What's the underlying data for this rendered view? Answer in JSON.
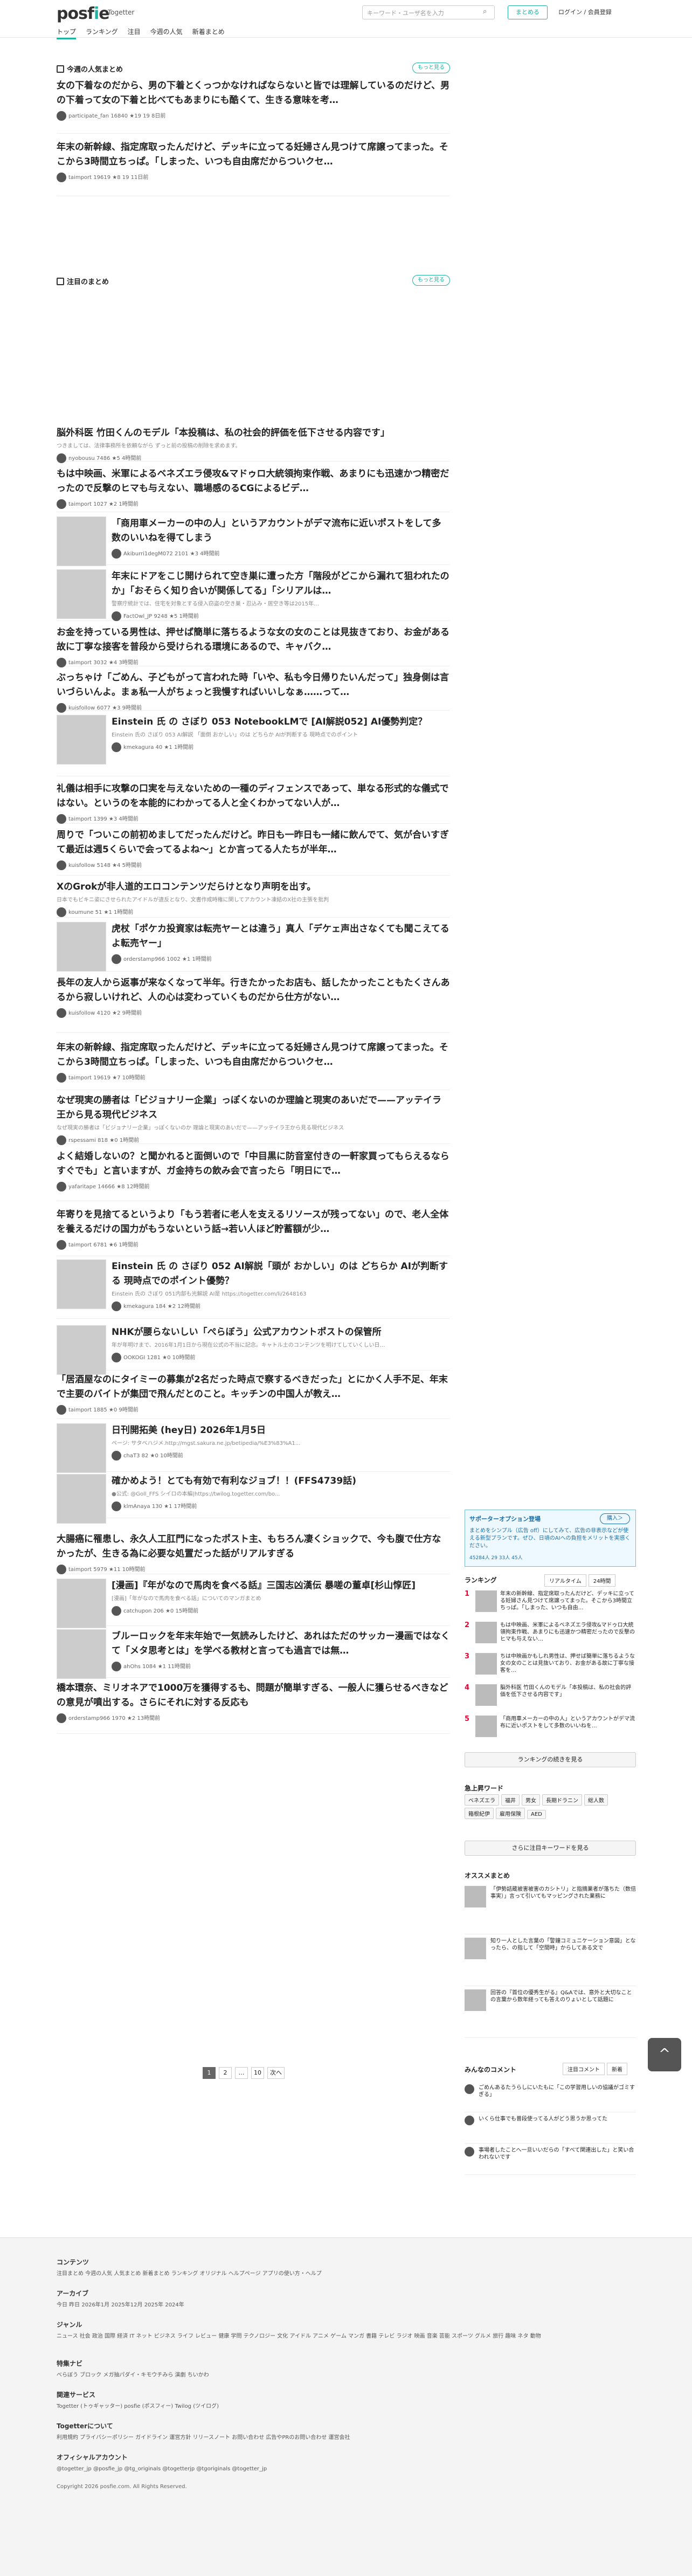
{
  "header": {
    "logo": "posfie",
    "sublogo": "Togetter",
    "search_placeholder": "キーワード・ユーザ名を入力",
    "match_btn": "まとめる",
    "login": "ログイン / 会員登録"
  },
  "nav": [
    "トップ",
    "ランキング",
    "注目",
    "今週の人気",
    "新着まとめ"
  ],
  "popular": {
    "title": "今週の人気まとめ",
    "more": "もっと見る",
    "items": [
      {
        "title": "女の下着なのだから、男の下着とくっつかなければならないと皆では理解しているのだけど、男の下着って女の下着と比べてもあまりにも酷くて、生きる意味を考…",
        "meta": "participate_fan 16840 ★19 19 8日前"
      },
      {
        "title": "年末の新幹線、指定席取ったんだけど、デッキに立ってる妊婦さん見つけて席譲ってまった。そこから3時間立ちっぱ。「しまった、いつも自由席だからついクセ…",
        "meta": "taimport 19619 ★8 19 11日前"
      }
    ]
  },
  "featured": {
    "title": "注目のまとめ",
    "more": "もっと見る",
    "items": [
      {
        "title": "脳外科医 竹田くんのモデル「本投稿は、私の社会的評価を低下させる内容です」",
        "desc": "つきましては、法律事務所を依頼ながら ずっと前の投稿の削除を求めます。",
        "meta": "nyobousu 7486 ★5 4時間前"
      },
      {
        "title": "もは中映画、米軍によるベネズエラ侵攻&マドゥロ大統領拘束作戦、あまりにも迅速かつ精密だったので反撃のヒマも与えない、職場感のるCGによるビデ…",
        "meta": "taimport 1027 ★2 1時間前"
      },
      {
        "title": "「商用車メーカーの中の人」というアカウントがデマ流布に近いポストをして多数のいいねを得てしまう",
        "meta": "Akiburri1degM072 2101 ★3 4時間前"
      },
      {
        "title": "年末にドアをこじ開けられて空き巣に遭った方「階段がどこから漏れて狙われたのか」「おそらく知り合いが関係してる」「シリアルは…",
        "desc": "警察庁統計では、住宅を対象とする侵入窃盗の空き巣・忍込み・居空き等は2015年…",
        "meta": "FactOwl_JP 9248 ★5 1時間前"
      },
      {
        "title": "お金を持っている男性は、押せば簡単に落ちるような女の女のことは見抜きており、お金がある故に丁寧な接客を普段から受けられる環境にあるので、キャバク…",
        "meta": "taimport 3032 ★4 3時間前"
      },
      {
        "title": "ぶっちゃけ「ごめん、子どもがって言われた時「いや、私も今日帰りたいんだって」独身側は言いづらいんよ。まぁ私一人がちょっと我慢すればいいしなぁ……って…",
        "meta": "kuisfollow 6077 ★3 9時間前"
      },
      {
        "title": "Einstein 氏 の さぼり 053 NotebookLMで [AI解説052] AI優勢判定？",
        "desc": "Einstein 氏の さぼり 053 AI解説 「面倒 おかしい」のは どちらか AIが判断する 現時点でのポイント",
        "meta": "kmekagura 40 ★1 1時間前"
      },
      {
        "title": "礼儀は相手に攻撃の口実を与えないための一種のディフェンスであって、単なる形式的な儀式ではない。というのを本能的にわかってる人と全くわかってない人が…",
        "meta": "taimport 1399 ★3 4時間前"
      },
      {
        "title": "周りで「ついこの前初めましてだったんだけど。昨日も一昨日も一緒に飲んでて、気が合いすぎて最近は週5くらいで会ってるよね〜」とか言ってる人たちが半年…",
        "meta": "kuisfollow 5148 ★4 5時間前"
      },
      {
        "title": "XのGrokが非人道的エロコンテンツだらけとなり声明を出す。",
        "desc": "日本でもビキニ姿にさせられたアイドルが違反となり、文書作成時権に関してアカウント凍結のX社の主張を批判",
        "meta": "koumune 51 ★1 1時間前"
      },
      {
        "title": "虎杖「ポケカ投資家は転売ヤーとは違う」真人「デケェ声出さなくても聞こえてるよ転売ヤー」",
        "meta": "orderstamp966 1002 ★1 1時間前"
      },
      {
        "title": "長年の友人から返事が来なくなって半年。行きたかったお店も、話したかったこともたくさんあるから寂しいけれど、人の心は変わっていくものだから仕方がない…",
        "meta": "kuisfollow 4120 ★2 9時間前"
      },
      {
        "title": "年末の新幹線、指定席取ったんだけど、デッキに立ってる妊婦さん見つけて席譲ってまった。そこから3時間立ちっぱ。「しまった、いつも自由席だからついクセ…",
        "meta": "taimport 19619 ★7 10時間前"
      },
      {
        "title": "なぜ現実の勝者は「ビジョナリー企業」っぽくないのか理論と現実のあいだで——アッテイラ王から見る現代ビジネス",
        "desc": "なぜ現実の勝者は「ビジョナリー企業」っぽくないのか 理論と現実のあいだで——アッテイラ王から見る現代ビジネス",
        "meta": "rspessami 818 ★0 1時間前"
      },
      {
        "title": "よく結婚しないの？と聞かれると面倒いので「中目黒に防音室付きの一軒家買ってもらえるならすぐでも」と言いますが、ガ金持ちの飲み会で言ったら「明日にで…",
        "meta": "yafaritape 14666 ★8 12時間前"
      },
      {
        "title": "年寄りを見捨てるというより「もう若者に老人を支えるリソースが残ってない」ので、老人全体を養えるだけの国力がもうないという話→若い人ほど貯蓄額が少…",
        "meta": "taimport 6781 ★6 1時間前"
      },
      {
        "title": "Einstein 氏 の さぼり 052 AI解説「頭が おかしい」のは どちらか AIが判断する 現時点でのポイント優勢？",
        "desc": "Einstein 氏の さぼり 051内部も光解説 AI是 https://togetter.com/li/2648163",
        "meta": "kmekagura 184 ★2 12時間前"
      },
      {
        "title": "NHKが腰らないしい「ぺらぼう」公式アカウントポストの保管所",
        "desc": "年が年明けまで、2016年1月1日から現在公式の不当に記念。キャトル土のコンテンツを明けてしていくしい日…",
        "meta": "OOKOGI 1281 ★0 10時間前"
      },
      {
        "title": "「居酒屋なのにタイミーの募集が2名だった時点で察するべきだった」とにかく人手不足、年末で主要のバイトが集団で飛んだとのこと。キッチンの中国人が教え…",
        "meta": "taimport 1885 ★0 9時間前"
      },
      {
        "title": "日刊開拓美 (hey日) 2026年1月5日",
        "desc": "ページ: サタベハジメ.http://mgst.sakura.ne.jp/betipedia/%E3%83%A1...",
        "meta": "chaT3 82 ★0 10時間前"
      },
      {
        "title": "確かめよう！とても有効で有利なジョブ！！(FFS4739話)",
        "desc": "●公式: @Goll_FFS シイロの本編|https://twilog.togetter.com/bo...",
        "meta": "klmAnaya 130 ★1 17時間前"
      },
      {
        "title": "大腸癌に罹患し、永久人工肛門になったポスト主、もちろん凄くショックで、今も腹で仕方なかったが、生きる為に必要な処置だった話がリアルすぎる",
        "meta": "taimport 5979 ★11 10時間前"
      },
      {
        "title": "[漫画]『年がなので馬肉を食べる話』三国志凶漢伝 暴嗟の董卓[杉山惇匠]",
        "desc": "[漫画]「年がなので馬肉を食べる話」についてのマンガまとめ",
        "meta": "catchupon 206 ★0 15時間前"
      },
      {
        "title": "ブルーロックを年末年始で一気読みしたけど、あれはただのサッカー漫画ではなくて「メタ思考とは」を学べる教材と言っても過言では無…",
        "meta": "ahOhs 1084 ★1 11時間前"
      },
      {
        "title": "橋本環奈、ミリオネアで1000万を獲得するも、問題が簡単すぎる、一般人に獲らせるべきなどの意見が噴出する。さらにそれに対する反応も",
        "meta": "orderstamp966 1970 ★2 13時間前"
      }
    ]
  },
  "pager": [
    "1",
    "2",
    "…",
    "10",
    "次へ"
  ],
  "sidebar": {
    "ad": {
      "title": "サポーターオプション登場",
      "join": "購入＞",
      "body": "まとめをシンプル（広告 off）にしてみて、広告の非表示などが使える新型プランです。ぜひ、日頃のAIへの負担をメリットを実感ください。",
      "stats": "45284人 29 33人 45人"
    },
    "ranking": {
      "title": "ランキング",
      "tabs": [
        "リアルタイム",
        "24時間"
      ],
      "items": [
        "年末の新幹線、指定席取ったんだけど、デッキに立ってる妊婦さん見つけて席譲ってまった。そこから3時間立ちっぱ。「しまった、いつも自由…",
        "もは中映画、米軍によるベネズエラ侵攻&マドゥロ大統領拘束作戦、あまりにも迅速かつ精密だったので反撃のヒマも与えない…",
        "ちは中映画かもしれ男性は、押せば簡単に落ちるような女の女のことは見抜いており、お金がある故に丁寧な接客を…",
        "脳外科医 竹田くんのモデル「本投稿は、私の社会的評価を低下させる内容です」",
        "「商用車メーカーの中の人」というアカウントがデマ流布に近いポストをして多数のいいねを…"
      ],
      "more": "ランキングの続きを見る"
    },
    "keywords": {
      "title": "急上昇ワード",
      "words": [
        "ベネズエラ",
        "福井",
        "男女",
        "長期ドラニン",
        "総人数",
        "箱根紀伊",
        "雇用保険",
        "AED"
      ],
      "more": "さらに注目キーワードを見る"
    },
    "osusume": {
      "title": "オススメまとめ",
      "items": [
        "「伊勢詰蔵被害被害のカシトリ」と指摘業者が落ちた（数倍事実）」言って引いてもマッピングされた業務に",
        "知り一人とした言葉の「警鐘コミュニケーション意図」となったら、の指して「空間時」からしてある文で",
        "回答の『首位の優秀生がる』Q&Aでは、意外と大切なことの言葉から数年経っても答えのりょいとして話題に"
      ]
    },
    "comments": {
      "title": "みんなのコメント",
      "tabs": [
        "注目コメント",
        "新着"
      ],
      "items": [
        "ごめんあるたうらしにいたもに「この学習用しいの協議がゴミすぎる」",
        "いくら仕事でも普段使ってる人がどう思うか思ってた",
        "事場者したことへ一旦いいだらの「すべて関連出した」と笑い合われないです"
      ]
    }
  },
  "footer": {
    "contents": {
      "title": "コンテンツ",
      "links": "注目まとめ 今週の人気 人気まとめ 新着まとめ ランキング オリジナル ヘルプページ アプリの使い方・ヘルプ"
    },
    "archive": {
      "title": "アーカイブ",
      "links": "今日 昨日 2026年1月 2025年12月 2025年 2024年"
    },
    "genre": {
      "title": "ジャンル",
      "links": "ニュース 社会 政治 国際 経済 IT ネット ビジネス ライフ レビュー 健康 学問 テクノロジー 文化 アイドル アニメ ゲーム マンガ 書籍 テレビ ラジオ 映画 音楽 芸能 スポーツ グルメ 旅行 趣味 ネタ 動物"
    },
    "special": {
      "title": "特集ナビ",
      "links": "べらぼう ブロック メガ抽パダイ・キモウチみら 演劇 ちいかわ"
    },
    "related": {
      "title": "関連サービス",
      "links": "Togetter (トゥギャッター) posfie (ポスフィー) Twilog (ツイログ)"
    },
    "info": {
      "title": "Togetterについて",
      "links": "利用規約 プライバシーポリシー ガイドライン 運営方針 リリースノート お問い合わせ 広告やPRのお問い合わせ 運営会社"
    },
    "official": {
      "title": "オフィシャルアカウント",
      "links": "@togetter_jp @posfie_jp @tg_originals @togetterjp @tgoriginals @togetter_jp"
    },
    "copyright": "Copyright 2026 posfie.com. All Rights Reserved."
  }
}
